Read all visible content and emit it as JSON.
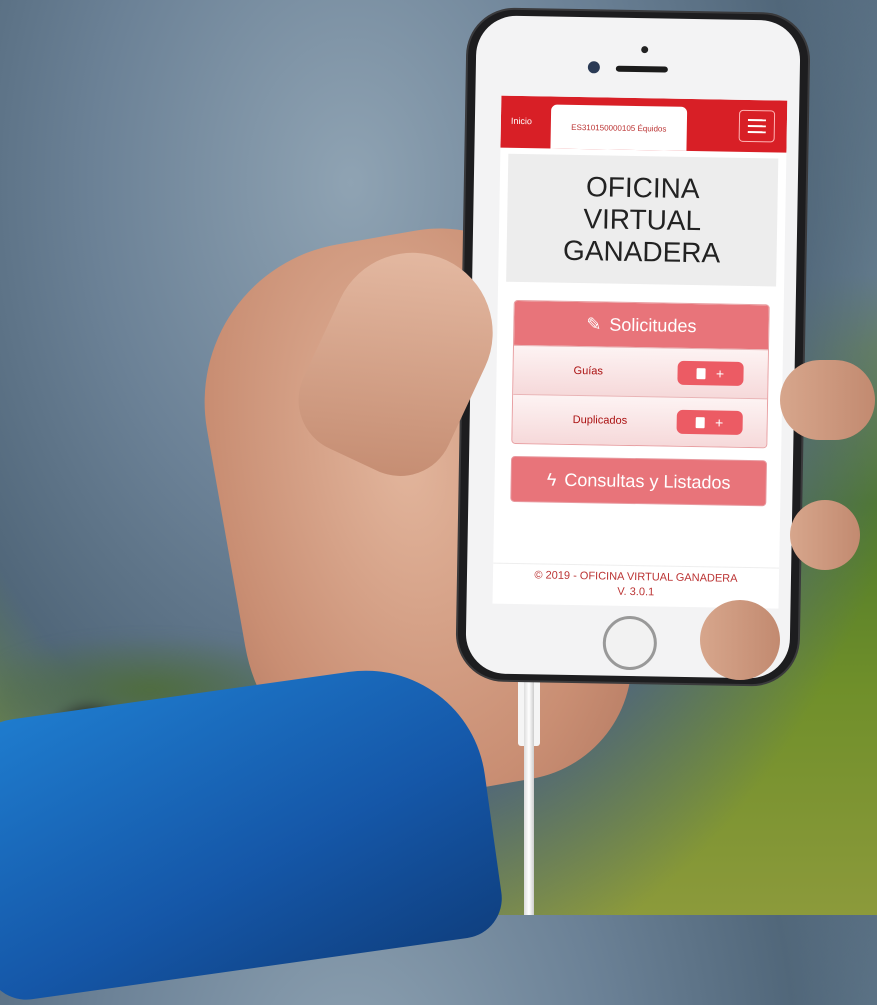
{
  "app": {
    "nav": {
      "home_tab": "Inicio",
      "active_tab": "ES310150000105 Équidos",
      "menu_icon": "hamburger-menu-icon"
    },
    "title": [
      "OFICINA",
      "VIRTUAL",
      "GANADERA"
    ],
    "solicitudes": {
      "header": "Solicitudes",
      "header_icon": "pencil-icon",
      "items": [
        {
          "label": "Guías",
          "actions_icon": "document-plus-icon"
        },
        {
          "label": "Duplicados",
          "actions_icon": "document-plus-icon"
        }
      ]
    },
    "consultas": {
      "label": "Consultas y Listados",
      "icon": "lightning-icon"
    },
    "footer": {
      "copyright": "© 2019 - OFICINA VIRTUAL GANADERA",
      "version": "V. 3.0.1"
    }
  },
  "colors": {
    "accent": "#d81f26",
    "panel_header": "#e8747a",
    "button": "#ec5b64"
  }
}
